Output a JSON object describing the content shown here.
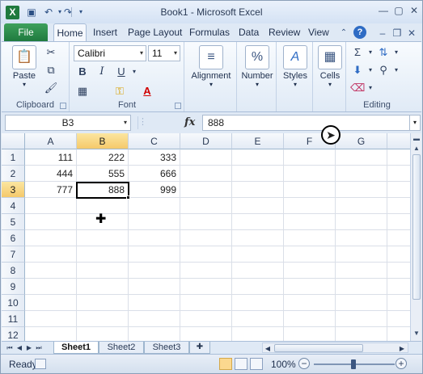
{
  "window": {
    "title": "Book1 - Microsoft Excel",
    "app_icon": "excel-icon",
    "qat": [
      "save-icon",
      "undo-icon",
      "redo-icon"
    ]
  },
  "ribbon": {
    "tabs": [
      "File",
      "Home",
      "Insert",
      "Page Layout",
      "Formulas",
      "Data",
      "Review",
      "View"
    ],
    "active_tab": "Home",
    "clipboard": {
      "paste_label": "Paste",
      "group_label": "Clipboard"
    },
    "font": {
      "name": "Calibri",
      "size": "11",
      "bold": "B",
      "italic": "I",
      "underline": "U",
      "font_color_glyph": "A",
      "group_label": "Font"
    },
    "alignment": {
      "label": "Alignment"
    },
    "number": {
      "label": "Number",
      "glyph": "%"
    },
    "styles": {
      "label": "Styles",
      "glyph": "A"
    },
    "cells": {
      "label": "Cells"
    },
    "editing": {
      "label": "Editing",
      "sum_glyph": "Σ"
    }
  },
  "formula_bar": {
    "name_box": "B3",
    "fx": "fx",
    "formula": "888"
  },
  "sheet": {
    "columns": [
      "A",
      "B",
      "C",
      "D",
      "E",
      "F",
      "G"
    ],
    "rows": [
      "1",
      "2",
      "3",
      "4",
      "5",
      "6",
      "7",
      "8",
      "9",
      "10",
      "11",
      "12"
    ],
    "cells": {
      "A1": "111",
      "B1": "222",
      "C1": "333",
      "A2": "444",
      "B2": "555",
      "C2": "666",
      "A3": "777",
      "B3": "888",
      "C3": "999"
    },
    "selected": "B3"
  },
  "sheet_tabs": [
    "Sheet1",
    "Sheet2",
    "Sheet3"
  ],
  "active_sheet": "Sheet1",
  "status": {
    "text": "Ready",
    "zoom": "100%",
    "accent": "#1f7a3e"
  }
}
